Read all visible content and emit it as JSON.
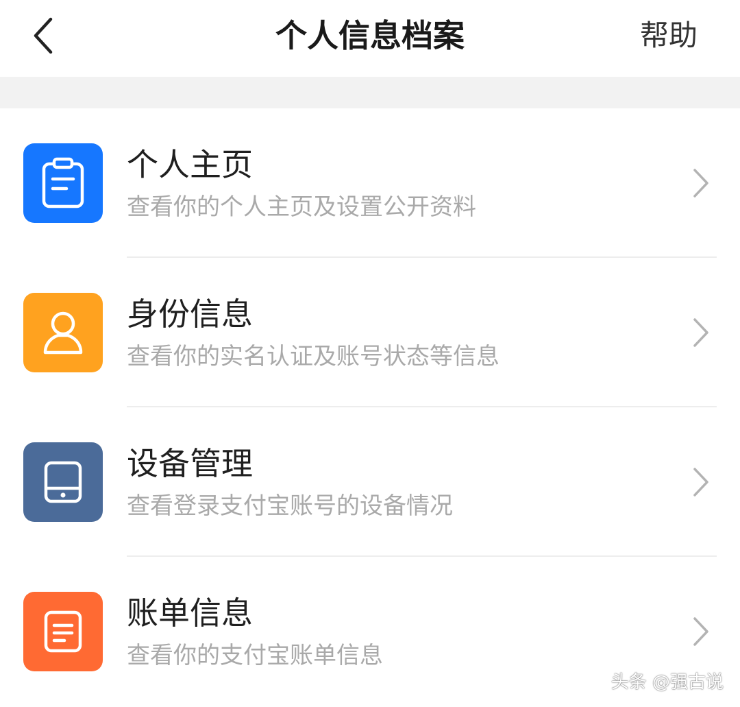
{
  "header": {
    "title": "个人信息档案",
    "help_label": "帮助",
    "back_icon": "chevron-left-icon"
  },
  "items": [
    {
      "title": "个人主页",
      "subtitle": "查看你的个人主页及设置公开资料",
      "icon": "clipboard-icon",
      "color": "#1677ff"
    },
    {
      "title": "身份信息",
      "subtitle": "查看你的实名认证及账号状态等信息",
      "icon": "person-icon",
      "color": "#ffa21f"
    },
    {
      "title": "设备管理",
      "subtitle": "查看登录支付宝账号的设备情况",
      "icon": "tablet-icon",
      "color": "#4b6b99"
    },
    {
      "title": "账单信息",
      "subtitle": "查看你的支付宝账单信息",
      "icon": "bill-icon",
      "color": "#ff6a33"
    }
  ],
  "watermark": "头条 @强古说"
}
